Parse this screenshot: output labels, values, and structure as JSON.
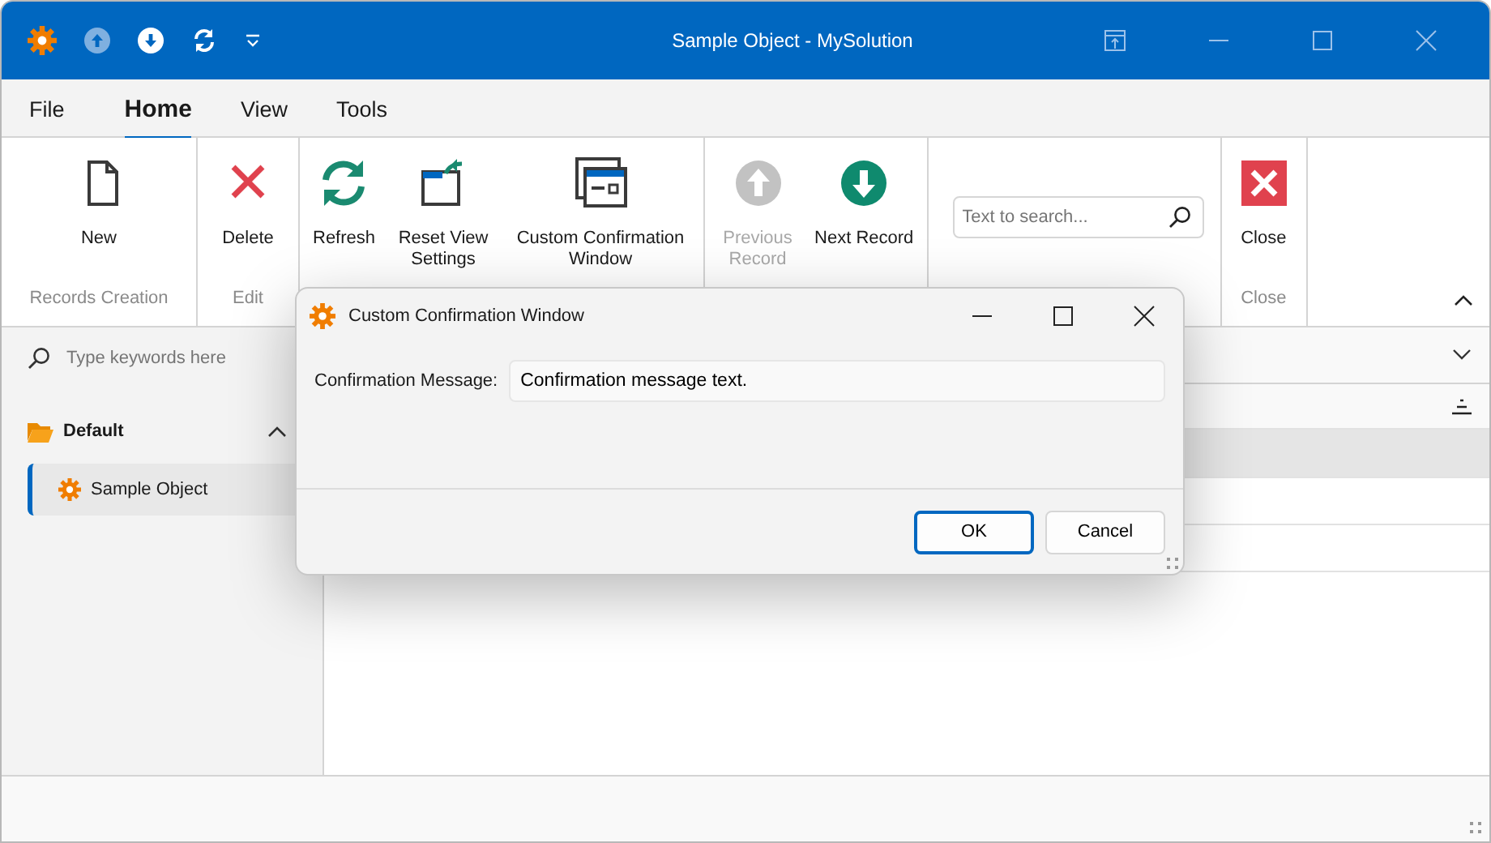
{
  "window": {
    "title": "Sample Object - MySolution"
  },
  "quick_access": [
    {
      "kind": "up",
      "disabled": true
    },
    {
      "kind": "down",
      "disabled": false
    },
    {
      "kind": "refresh",
      "disabled": false
    }
  ],
  "menu_tabs": [
    {
      "label": "File",
      "selected": false
    },
    {
      "label": "Home",
      "selected": true
    },
    {
      "label": "View",
      "selected": false
    },
    {
      "label": "Tools",
      "selected": false
    }
  ],
  "ribbon": {
    "expanded": true,
    "groups": [
      {
        "caption": "Records Creation",
        "buttons": [
          {
            "kind": "new",
            "label": "New",
            "disabled": false
          }
        ]
      },
      {
        "caption": "Edit",
        "buttons": [
          {
            "kind": "delete",
            "label": "Delete",
            "disabled": false
          }
        ]
      },
      {
        "buttons": [
          {
            "kind": "refresh",
            "label": "Refresh",
            "disabled": false
          },
          {
            "kind": "reset",
            "label": "Reset View Settings",
            "disabled": false
          },
          {
            "kind": "window",
            "label": "Custom Confirmation Window",
            "disabled": false
          }
        ]
      },
      {
        "buttons": [
          {
            "kind": "previous",
            "label": "Previous Record",
            "disabled": true
          },
          {
            "kind": "next",
            "label": "Next Record",
            "disabled": false
          }
        ]
      },
      {
        "search": {
          "placeholder": "Text to search..."
        }
      },
      {
        "caption": "Close",
        "buttons": [
          {
            "kind": "close",
            "label": "Close",
            "disabled": false
          }
        ]
      }
    ]
  },
  "navigation": {
    "search": {
      "placeholder": "Type keywords here"
    },
    "groups": [
      {
        "label": "Default",
        "expanded": true,
        "items": [
          {
            "label": "Sample Object",
            "selected": true
          }
        ]
      }
    ]
  },
  "dialog": {
    "title": "Custom Confirmation Window",
    "field": {
      "label": "Confirmation Message:",
      "value": "Confirmation message text."
    },
    "buttons": [
      {
        "label": "OK",
        "default": true
      },
      {
        "label": "Cancel",
        "default": false
      }
    ]
  }
}
